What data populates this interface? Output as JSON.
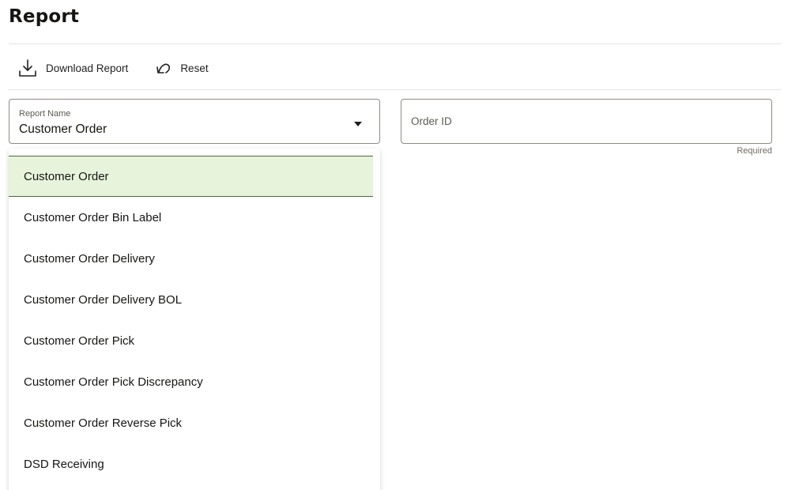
{
  "page": {
    "title": "Report"
  },
  "toolbar": {
    "download_label": "Download Report",
    "reset_label": "Reset"
  },
  "report_select": {
    "label": "Report Name",
    "value": "Customer Order"
  },
  "order_id": {
    "placeholder": "Order ID",
    "value": "",
    "helper": "Required"
  },
  "dropdown": {
    "options": [
      {
        "label": "Customer Order",
        "selected": true
      },
      {
        "label": "Customer Order Bin Label",
        "selected": false
      },
      {
        "label": "Customer Order Delivery",
        "selected": false
      },
      {
        "label": "Customer Order Delivery BOL",
        "selected": false
      },
      {
        "label": "Customer Order Pick",
        "selected": false
      },
      {
        "label": "Customer Order Pick Discrepancy",
        "selected": false
      },
      {
        "label": "Customer Order Reverse Pick",
        "selected": false
      },
      {
        "label": "DSD Receiving",
        "selected": false
      }
    ]
  },
  "icons": {
    "download": "download-icon",
    "reset": "undo-icon",
    "caret": "caret-down-icon"
  },
  "colors": {
    "selected_bg": "#e8f3dc",
    "selected_border": "#4b6b3a"
  }
}
